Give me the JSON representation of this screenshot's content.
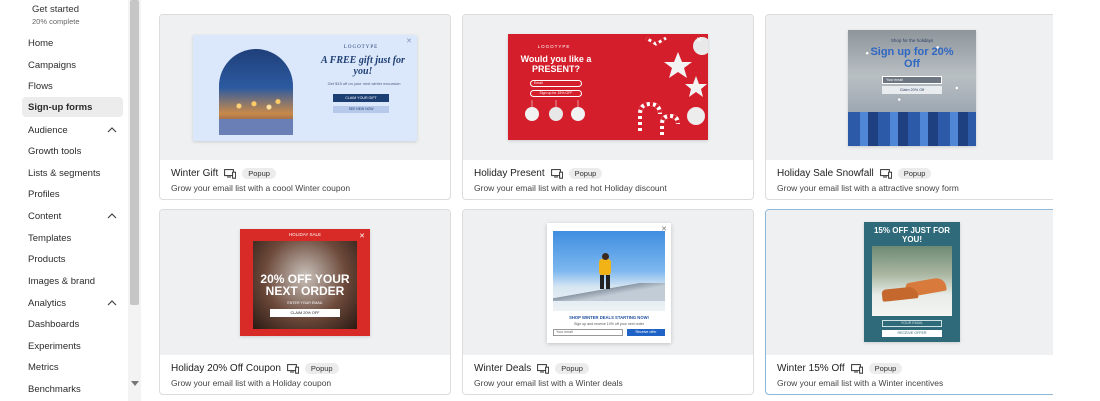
{
  "sidebar": {
    "get_started": {
      "title": "Get started",
      "subtitle": "20% complete"
    },
    "items": [
      {
        "label": "Home"
      },
      {
        "label": "Campaigns"
      },
      {
        "label": "Flows"
      },
      {
        "label": "Sign-up forms",
        "active": true
      },
      {
        "label": "Audience",
        "expanded": true
      },
      {
        "label": "Growth tools"
      },
      {
        "label": "Lists & segments"
      },
      {
        "label": "Profiles"
      },
      {
        "label": "Content",
        "expanded": true
      },
      {
        "label": "Templates"
      },
      {
        "label": "Products"
      },
      {
        "label": "Images & brand"
      },
      {
        "label": "Analytics",
        "expanded": true
      },
      {
        "label": "Dashboards"
      },
      {
        "label": "Experiments"
      },
      {
        "label": "Metrics"
      },
      {
        "label": "Benchmarks"
      }
    ]
  },
  "badge_label": "Popup",
  "cards": [
    {
      "name": "Winter Gift",
      "desc": "Grow your email list with a coool Winter coupon",
      "preview": {
        "logotype": "LOGOTYPE",
        "headline": "A FREE gift just for you!",
        "body": "Get $15 off on your next winter excursion",
        "cta": "CLAIM YOUR GIFT",
        "secondary": "SEE NEW NOW"
      }
    },
    {
      "name": "Holiday Present",
      "desc": "Grow your email list with a red hot Holiday discount",
      "preview": {
        "logotype": "LOGOTYPE",
        "headline": "Would you like a PRESENT?",
        "email": "Email",
        "cta": "Sign up for 15% OFF"
      }
    },
    {
      "name": "Holiday Sale Snowfall",
      "desc": "Grow your email list with a attractive snowy form",
      "preview": {
        "kicker": "Shop for the holidays",
        "headline": "Sign up for 20% Off",
        "email": "Your email",
        "cta": "Claim 20% Off"
      }
    },
    {
      "name": "Holiday 20% Off Coupon",
      "desc": "Grow your email list with a Holiday coupon",
      "preview": {
        "kicker": "HOLIDAY SALE",
        "headline": "20% OFF YOUR NEXT ORDER",
        "email": "ENTER YOUR EMAIL",
        "cta": "CLAIM 20% OFF"
      }
    },
    {
      "name": "Winter Deals",
      "desc": "Grow your email list with a Winter deals",
      "preview": {
        "headline": "SHOP WINTER DEALS STARTING NOW!",
        "body": "Sign up and receive 10% off your next order",
        "email": "Your email",
        "cta": "Receive offer"
      }
    },
    {
      "name": "Winter 15% Off",
      "desc": "Grow your email list with a Winter incentives",
      "preview": {
        "headline": "15% OFF JUST FOR YOU!",
        "email": "YOUR EMAIL",
        "cta": "RECEIVE OFFER"
      }
    }
  ]
}
